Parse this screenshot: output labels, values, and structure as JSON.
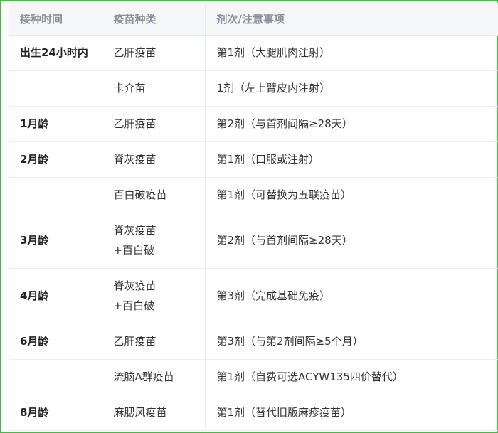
{
  "table": {
    "headers": [
      "接种时间",
      "疫苗种类",
      "剂次/注意事项"
    ],
    "rows": [
      {
        "time": "出生24小时内",
        "vaccine": [
          "乙肝疫苗"
        ],
        "note": "第1剂（大腿肌肉注射）"
      },
      {
        "time": "",
        "vaccine": [
          "卡介苗"
        ],
        "note": "1剂（左上臂皮内注射）"
      },
      {
        "time": "1月龄",
        "vaccine": [
          "乙肝疫苗"
        ],
        "note": "第2剂（与首剂间隔≥28天）"
      },
      {
        "time": "2月龄",
        "vaccine": [
          "脊灰疫苗"
        ],
        "note": "第1剂（口服或注射）"
      },
      {
        "time": "",
        "vaccine": [
          "百白破疫苗"
        ],
        "note": "第1剂（可替换为五联疫苗）"
      },
      {
        "time": "3月龄",
        "vaccine": [
          "脊灰疫苗",
          "+百白破"
        ],
        "note": "第2剂（与首剂间隔≥28天）"
      },
      {
        "time": "4月龄",
        "vaccine": [
          "脊灰疫苗",
          "+百白破"
        ],
        "note": "第3剂（完成基础免疫）"
      },
      {
        "time": "6月龄",
        "vaccine": [
          "乙肝疫苗"
        ],
        "note": "第3剂（与第2剂间隔≥5个月）"
      },
      {
        "time": "",
        "vaccine": [
          "流脑A群疫苗"
        ],
        "note": "第1剂（自费可选ACYW135四价替代）"
      },
      {
        "time": "8月龄",
        "vaccine": [
          "麻腮风疫苗"
        ],
        "note": "第1剂（替代旧版麻疹疫苗）"
      }
    ]
  },
  "colors": {
    "frame_border": "#3fbf3f",
    "header_bg": "#f5f6f8",
    "header_text": "#8a8f99",
    "body_text": "#333333"
  }
}
